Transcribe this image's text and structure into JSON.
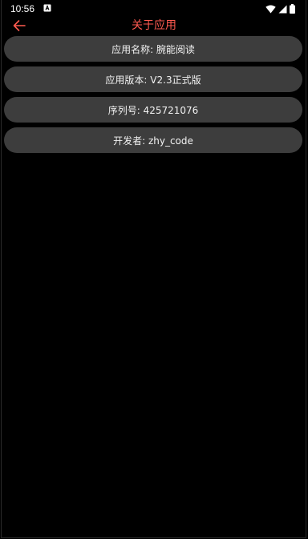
{
  "status_bar": {
    "time": "10:56",
    "notification_icon": "a-notification-icon",
    "wifi_icon": "wifi-icon",
    "signal_icon": "signal-icon",
    "battery_icon": "battery-icon"
  },
  "app_bar": {
    "back_icon": "arrow-left-icon",
    "title": "关于应用",
    "accent_color": "#ff5a50"
  },
  "info_items": [
    {
      "text": "应用名称: 腕能阅读"
    },
    {
      "text": "应用版本: V2.3正式版"
    },
    {
      "text": "序列号: 425721076"
    },
    {
      "text": "开发者: zhy_code"
    }
  ],
  "colors": {
    "background": "#000000",
    "item_background": "#3d3d3d",
    "item_text": "#f2f2f2"
  }
}
